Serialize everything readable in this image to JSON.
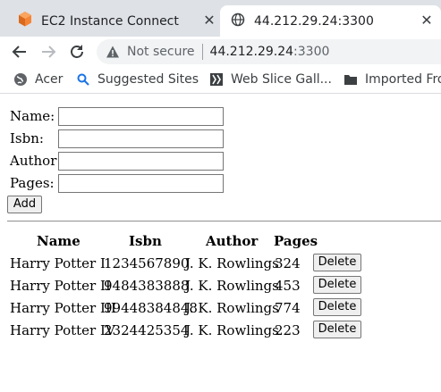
{
  "browser": {
    "tabs": [
      {
        "title": "EC2 Instance Connect",
        "icon": "aws-cube-icon",
        "active": false
      },
      {
        "title": "44.212.29.24:3300",
        "icon": "globe-icon",
        "active": true
      }
    ],
    "address": {
      "security_label": "Not secure",
      "host": "44.212.29.24",
      "port": ":3300"
    },
    "bookmarks": [
      {
        "label": "Acer",
        "icon": "acer-globe-icon"
      },
      {
        "label": "Suggested Sites",
        "icon": "search-icon"
      },
      {
        "label": "Web Slice Gall...",
        "icon": "web-slice-icon"
      },
      {
        "label": "Imported Fro",
        "icon": "folder-icon"
      }
    ]
  },
  "form": {
    "fields": [
      {
        "label": "Name:",
        "value": ""
      },
      {
        "label": "Isbn:",
        "value": ""
      },
      {
        "label": "Author:",
        "value": ""
      },
      {
        "label": "Pages:",
        "value": ""
      }
    ],
    "add_label": "Add"
  },
  "table": {
    "headers": [
      "Name",
      "Isbn",
      "Author",
      "Pages"
    ],
    "rows": [
      {
        "name": "Harry Potter I",
        "isbn": "1234567890",
        "author": "J. K. Rowlings",
        "pages": "324",
        "action": "Delete"
      },
      {
        "name": "Harry Potter II",
        "isbn": "9484383888",
        "author": "J. K. Rowlings",
        "pages": "453",
        "action": "Delete"
      },
      {
        "name": "Harry Potter III",
        "isbn": "99448384848",
        "author": "J. K. Rowlings",
        "pages": "774",
        "action": "Delete"
      },
      {
        "name": "Harry Potter IV",
        "isbn": "2324425354",
        "author": "J. K. Rowlings",
        "pages": "223",
        "action": "Delete"
      }
    ]
  },
  "colors": {
    "tabstrip_bg": "#dee1e6",
    "omnibox_bg": "#f1f3f4",
    "aws_orange": "#f58536"
  }
}
